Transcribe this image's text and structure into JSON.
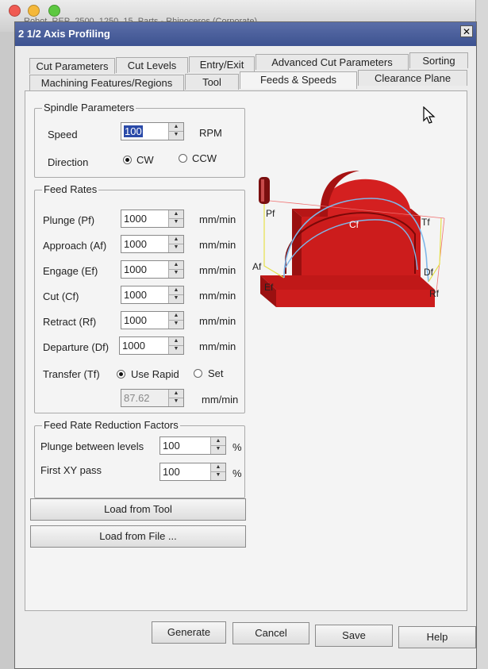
{
  "host": {
    "window_title": "Robot_REP_2500_1250_15_Parts - Rhinoceros (Corporate)"
  },
  "dialog": {
    "title": "2 1/2 Axis Profiling",
    "close_glyph": "✕"
  },
  "tabs": {
    "row1": [
      "Cut Parameters",
      "Cut Levels",
      "Entry/Exit",
      "Advanced Cut Parameters",
      "Sorting"
    ],
    "row2": [
      "Machining Features/Regions",
      "Tool",
      "Feeds & Speeds",
      "Clearance Plane"
    ],
    "active": "Feeds & Speeds"
  },
  "spindle": {
    "legend": "Spindle Parameters",
    "speed_label": "Speed",
    "speed_value": "100",
    "speed_unit": "RPM",
    "direction_label": "Direction",
    "cw_label": "CW",
    "ccw_label": "CCW",
    "direction_selected": "CW"
  },
  "feed_rates": {
    "legend": "Feed Rates",
    "rows": [
      {
        "label": "Plunge (Pf)",
        "value": "1000",
        "unit": "mm/min"
      },
      {
        "label": "Approach (Af)",
        "value": "1000",
        "unit": "mm/min"
      },
      {
        "label": "Engage (Ef)",
        "value": "1000",
        "unit": "mm/min"
      },
      {
        "label": "Cut (Cf)",
        "value": "1000",
        "unit": "mm/min"
      },
      {
        "label": "Retract (Rf)",
        "value": "1000",
        "unit": "mm/min"
      },
      {
        "label": "Departure  (Df)",
        "value": "1000",
        "unit": "mm/min"
      }
    ],
    "transfer_label": "Transfer (Tf)",
    "use_rapid_label": "Use Rapid",
    "set_label": "Set",
    "transfer_selected": "Use Rapid",
    "transfer_value": "87.62",
    "transfer_unit": "mm/min"
  },
  "reduction": {
    "legend": "Feed Rate Reduction Factors",
    "plunge_label": "Plunge between levels",
    "plunge_value": "100",
    "first_pass_label": "First XY pass",
    "first_pass_value": "100",
    "unit": "%"
  },
  "load_buttons": {
    "from_tool": "Load from Tool",
    "from_file": "Load from File ..."
  },
  "diagram_labels": {
    "pf": "Pf",
    "cf": "Cf",
    "tf": "Tf",
    "af": "Af",
    "ef": "Ef",
    "df": "Df",
    "rf": "Rf"
  },
  "footer_buttons": {
    "generate": "Generate",
    "cancel": "Cancel",
    "save": "Save",
    "help": "Help"
  },
  "colors": {
    "title_bar": "#3d5290",
    "block_red": "#cc1c1c",
    "cut_path": "#7fb7e8",
    "retract_path": "#e6e14a"
  }
}
